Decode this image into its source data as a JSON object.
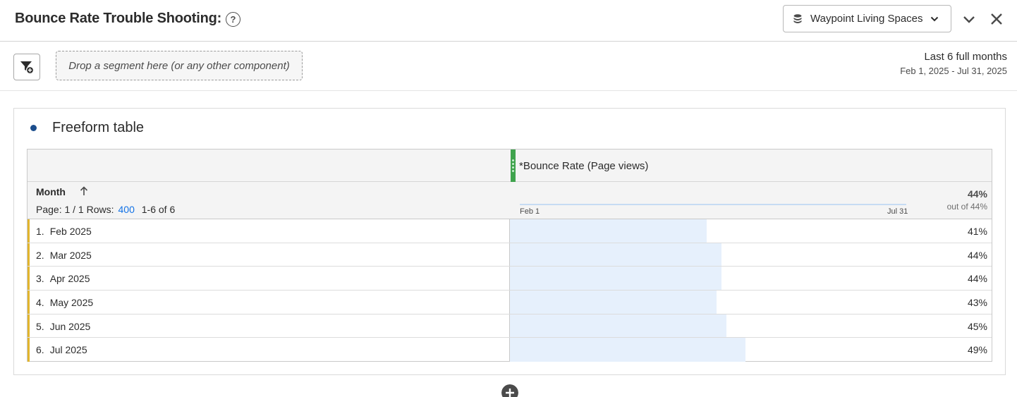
{
  "header": {
    "title": "Bounce Rate Trouble Shooting:",
    "help_icon": "question-circle-icon",
    "report_suite": "Waypoint Living Spaces"
  },
  "segment_bar": {
    "dropzone_text": "Drop a segment here (or any other component)",
    "date_range_label": "Last 6 full months",
    "date_range_value": "Feb 1, 2025 - Jul 31, 2025"
  },
  "panel": {
    "title": "Freeform table",
    "table": {
      "metric_header": "*Bounce Rate (Page views)",
      "dimension_header": "Month",
      "page_label": "Page: 1 / 1",
      "rows_label": "Rows:",
      "rows_value": "400",
      "range_label": "1-6 of 6",
      "sparkline_start": "Feb 1",
      "sparkline_end": "Jul 31",
      "total": "44%",
      "total_of": "out of 44%",
      "rows": [
        {
          "num": "1.",
          "label": "Feb 2025",
          "pct": "41%",
          "value": 41
        },
        {
          "num": "2.",
          "label": "Mar 2025",
          "pct": "44%",
          "value": 44
        },
        {
          "num": "3.",
          "label": "Apr 2025",
          "pct": "44%",
          "value": 44
        },
        {
          "num": "4.",
          "label": "May 2025",
          "pct": "43%",
          "value": 43
        },
        {
          "num": "5.",
          "label": "Jun 2025",
          "pct": "45%",
          "value": 45
        },
        {
          "num": "6.",
          "label": "Jul 2025",
          "pct": "49%",
          "value": 49
        }
      ]
    }
  },
  "colors": {
    "accent_green": "#3fa34d",
    "row_marker": "#e2b52d",
    "bar_fill": "#e6f0fc",
    "link": "#1473e6"
  }
}
